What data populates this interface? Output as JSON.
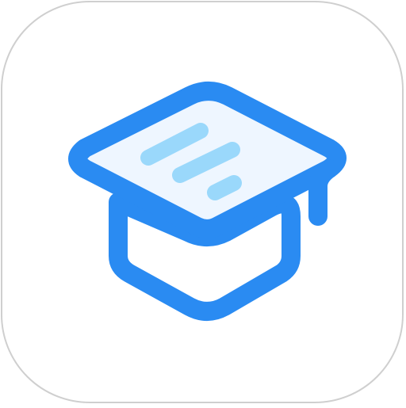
{
  "app_icon": {
    "icon": "graduation-cap-icon",
    "colors": {
      "background": "#ffffff",
      "border": "#cfcfcf",
      "outline": "#2a8bf2",
      "cap_fill": "#eef6ff",
      "text_lines": "#9ad8fb"
    }
  }
}
